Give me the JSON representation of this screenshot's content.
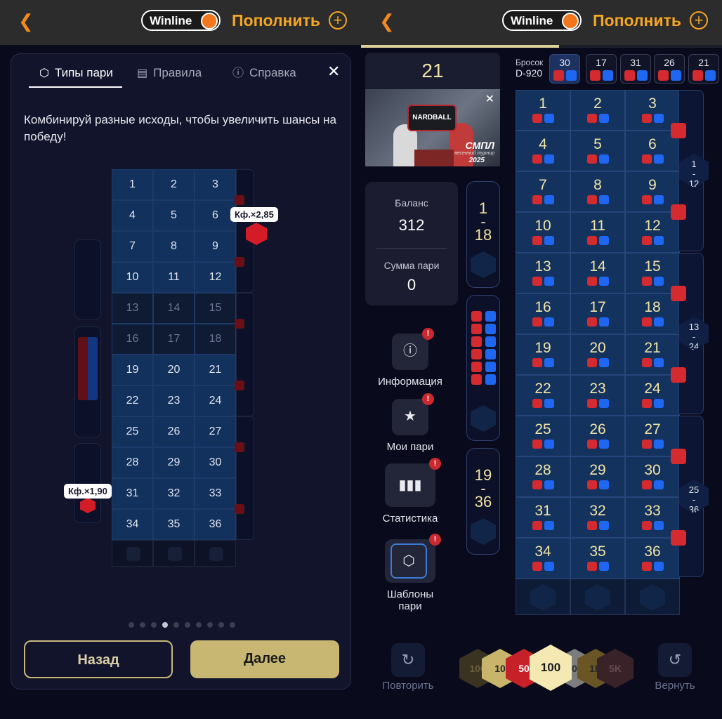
{
  "header": {
    "brand": "Winline",
    "deposit_label": "Пополнить",
    "back_icon": "chevron-left-icon",
    "plus_icon": "plus-circle-icon"
  },
  "modal": {
    "tabs": [
      {
        "label": "Типы пари",
        "icon": "hexagon-icon"
      },
      {
        "label": "Правила",
        "icon": "document-icon"
      },
      {
        "label": "Справка",
        "icon": "info-icon"
      }
    ],
    "intro": "Комбинируй разные исходы, чтобы увеличить шансы на победу!",
    "odds_top": "Кф.×2,85",
    "odds_bottom": "Кф.×1,90",
    "page_index": 4,
    "page_count": 10,
    "back_button": "Назад",
    "next_button": "Далее"
  },
  "grid_numbers": [
    1,
    2,
    3,
    4,
    5,
    6,
    7,
    8,
    9,
    10,
    11,
    12,
    13,
    14,
    15,
    16,
    17,
    18,
    19,
    20,
    21,
    22,
    23,
    24,
    25,
    26,
    27,
    28,
    29,
    30,
    31,
    32,
    33,
    34,
    35,
    36
  ],
  "game": {
    "round": "21",
    "video": {
      "title": "NARDBALL",
      "brand": "СМПЛ",
      "sub": "весенний турнир",
      "year": "2025"
    },
    "roll_label": "Бросок",
    "dealer": "D-920",
    "history": [
      {
        "n": "30"
      },
      {
        "n": "17"
      },
      {
        "n": "31"
      },
      {
        "n": "26"
      },
      {
        "n": "21"
      }
    ],
    "balance_label": "Баланс",
    "balance": "312",
    "bet_label": "Сумма пари",
    "bet": "0",
    "ranges": [
      {
        "a": "1",
        "b": "18"
      },
      {
        "a": "19",
        "b": "36"
      }
    ],
    "dozens": [
      {
        "a": "1",
        "b": "12"
      },
      {
        "a": "13",
        "b": "24"
      },
      {
        "a": "25",
        "b": "36"
      }
    ],
    "menu": [
      {
        "label": "Информация",
        "icon": "info-icon"
      },
      {
        "label": "Мои пари",
        "icon": "bets-icon"
      },
      {
        "label": "Статистика",
        "icon": "chart-icon"
      },
      {
        "label": "Шаблоны пари",
        "icon": "hexagon-icon"
      }
    ],
    "chips": [
      "100",
      "10",
      "50",
      "100",
      "500",
      "1K",
      "5K"
    ],
    "repeat_label": "Повторить",
    "undo_label": "Вернуть"
  }
}
